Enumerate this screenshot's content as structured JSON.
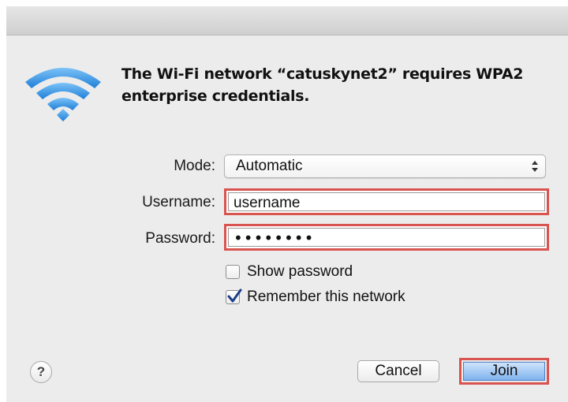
{
  "dialog": {
    "message": "The Wi-Fi network “catuskynet2” requires WPA2 enterprise credentials.",
    "icon": "wifi-icon"
  },
  "form": {
    "mode_label": "Mode:",
    "mode_value": "Automatic",
    "username_label": "Username:",
    "username_value": "username",
    "password_label": "Password:",
    "password_masked": "••••••••",
    "show_password_label": "Show password",
    "show_password_checked": false,
    "remember_label": "Remember this network",
    "remember_checked": true
  },
  "buttons": {
    "help_label": "?",
    "cancel_label": "Cancel",
    "join_label": "Join"
  },
  "colors": {
    "highlight": "#d9534f",
    "join_button": "#7fb2ee",
    "wifi_blue": "#3d9bea"
  }
}
